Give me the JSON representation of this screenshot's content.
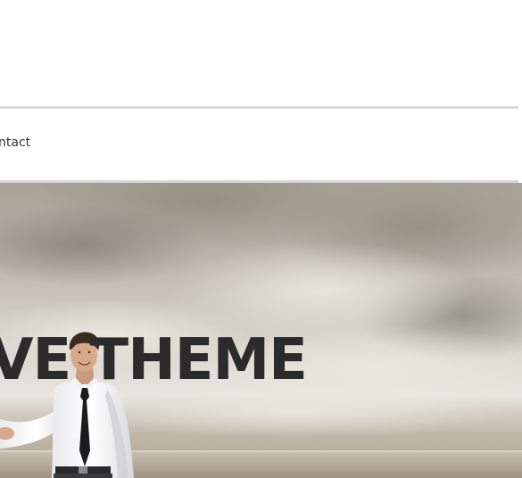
{
  "nav": {
    "contact_label": "ntact"
  },
  "hero": {
    "title": "VE THEME"
  },
  "colors": {
    "divider": "#d9d9d9",
    "title_text": "#2b2b2b",
    "nav_text": "#333333"
  }
}
